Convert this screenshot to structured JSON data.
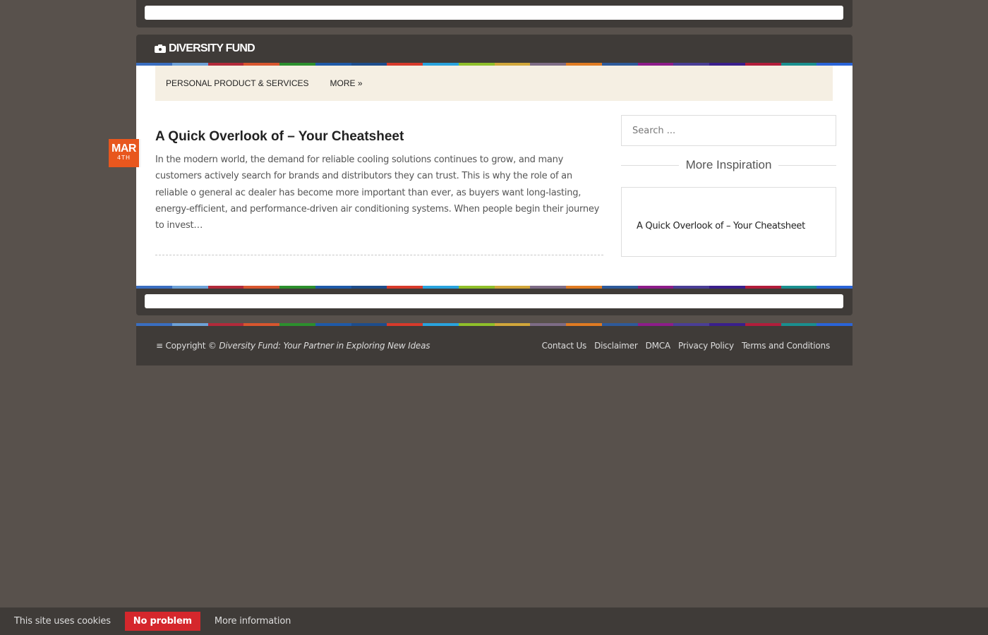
{
  "site": {
    "logo_text": "DIVERSITY FUND",
    "logo_icon": "camera-icon"
  },
  "stripe_colors": [
    "#3a6ec0",
    "#6da1d7",
    "#b22a3a",
    "#d8562e",
    "#2c8f2d",
    "#1f5aa8",
    "#1e4d8c",
    "#d73a2b",
    "#29a3dd",
    "#8fbf2a",
    "#d1a63a",
    "#7e6c86",
    "#e07b22",
    "#2e5a9a",
    "#8d1c8a",
    "#4a3e96",
    "#3a1f8c",
    "#b21d3b",
    "#1a8f8f",
    "#2a64d8"
  ],
  "nav": {
    "items": [
      "PERSONAL PRODUCT & SERVICES",
      "MORE »"
    ]
  },
  "post": {
    "date_month": "MAR",
    "date_day": "4TH",
    "title": "A Quick Overlook of – Your Cheatsheet",
    "excerpt": "In the modern world, the demand for reliable cooling solutions continues to grow, and many customers actively search for brands and distributors they can trust. This is why the role of an reliable o general ac dealer has become more important than ever, as buyers want long-lasting, energy-efficient, and performance-driven air conditioning systems. When people begin their journey to invest…"
  },
  "sidebar": {
    "search_placeholder": "Search ...",
    "widget_title": "More Inspiration",
    "widget_link": "A Quick Overlook of – Your Cheatsheet"
  },
  "footer": {
    "copyright_prefix": "≡ Copyright ©",
    "copyright_site": "Diversity Fund: Your Partner in Exploring New Ideas",
    "links": [
      "Contact Us",
      "Disclaimer",
      "DMCA",
      "Privacy Policy",
      "Terms and Conditions"
    ]
  },
  "cookie": {
    "message": "This site uses cookies",
    "button": "No problem",
    "more": "More information",
    "button_color": "#d5272c"
  }
}
